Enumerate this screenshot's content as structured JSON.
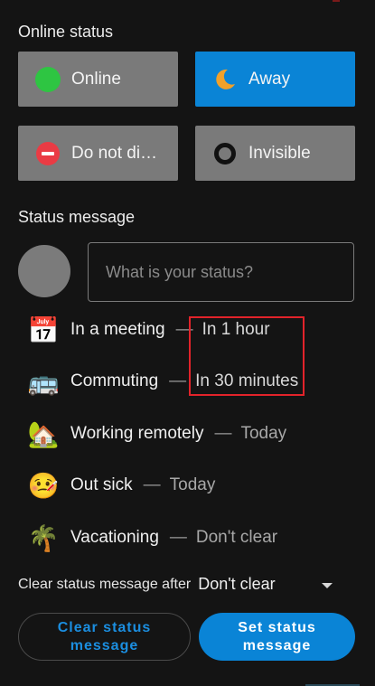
{
  "online_status": {
    "title": "Online status",
    "options": [
      {
        "label": "Online",
        "icon": "green-dot-icon",
        "selected": false
      },
      {
        "label": "Away",
        "icon": "crescent-moon-icon",
        "selected": true
      },
      {
        "label": "Do not di…",
        "icon": "do-not-disturb-icon",
        "selected": false
      },
      {
        "label": "Invisible",
        "icon": "invisible-ring-icon",
        "selected": false
      }
    ]
  },
  "status_message": {
    "title": "Status message",
    "input_placeholder": "What is your status?",
    "input_value": ""
  },
  "presets": [
    {
      "emoji": "📅",
      "name": "In a meeting",
      "dash": "—",
      "duration": "In 1 hour"
    },
    {
      "emoji": "🚌",
      "name": "Commuting",
      "dash": "—",
      "duration": "In 30 minutes"
    },
    {
      "emoji": "🏡",
      "name": "Working remotely",
      "dash": "—",
      "duration": "Today"
    },
    {
      "emoji": "🤒",
      "name": "Out sick",
      "dash": "—",
      "duration": "Today"
    },
    {
      "emoji": "🌴",
      "name": "Vacationing",
      "dash": "—",
      "duration": "Don't clear"
    }
  ],
  "clear_after": {
    "label": "Clear status message after",
    "selected": "Don't clear"
  },
  "actions": {
    "clear_label": "Clear status message",
    "set_label": "Set status message"
  },
  "colors": {
    "accent": "#0a84d6",
    "online": "#2ec542",
    "dnd": "#ea3b44",
    "away": "#f0a12b",
    "highlight": "#e2232a"
  }
}
